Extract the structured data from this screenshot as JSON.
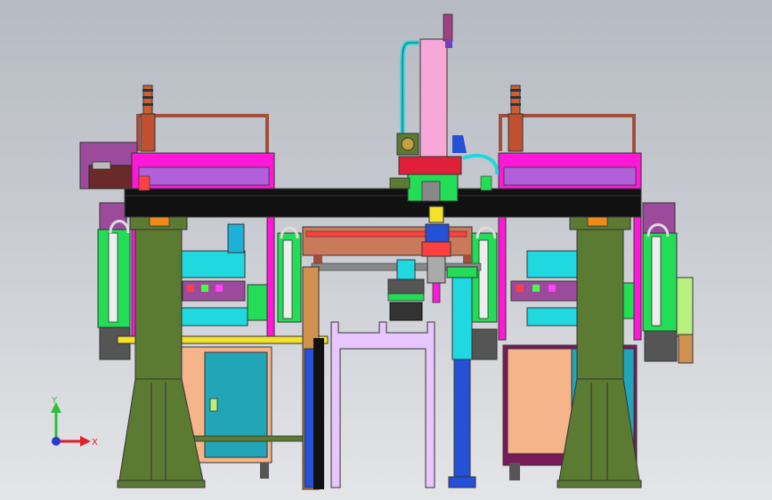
{
  "viewport": {
    "background_top": "#b6bac2",
    "background_bottom": "#e4e5e8"
  },
  "triad": {
    "x_label": "X",
    "y_label": "Y",
    "x_color": "#e0202a",
    "y_color": "#2cbf3a",
    "z_color": "#2a3ad0"
  },
  "colors": {
    "magenta_frame": "#ff18d8",
    "beam": "#111111",
    "pillar": "#5b7a32",
    "pink_column": "#f8a8d8",
    "teal": "#23a5b8",
    "cyan": "#1fd8e0",
    "blue_column": "#2550d8",
    "green_part": "#22dd55",
    "salmon": "#f5b48a",
    "brown_frame": "#a0503a",
    "yellow_rail": "#f2e22a",
    "lavender": "#e8c6ff",
    "red_block": "#e0203a"
  },
  "icons": [
    "coordinate-triad-icon"
  ]
}
